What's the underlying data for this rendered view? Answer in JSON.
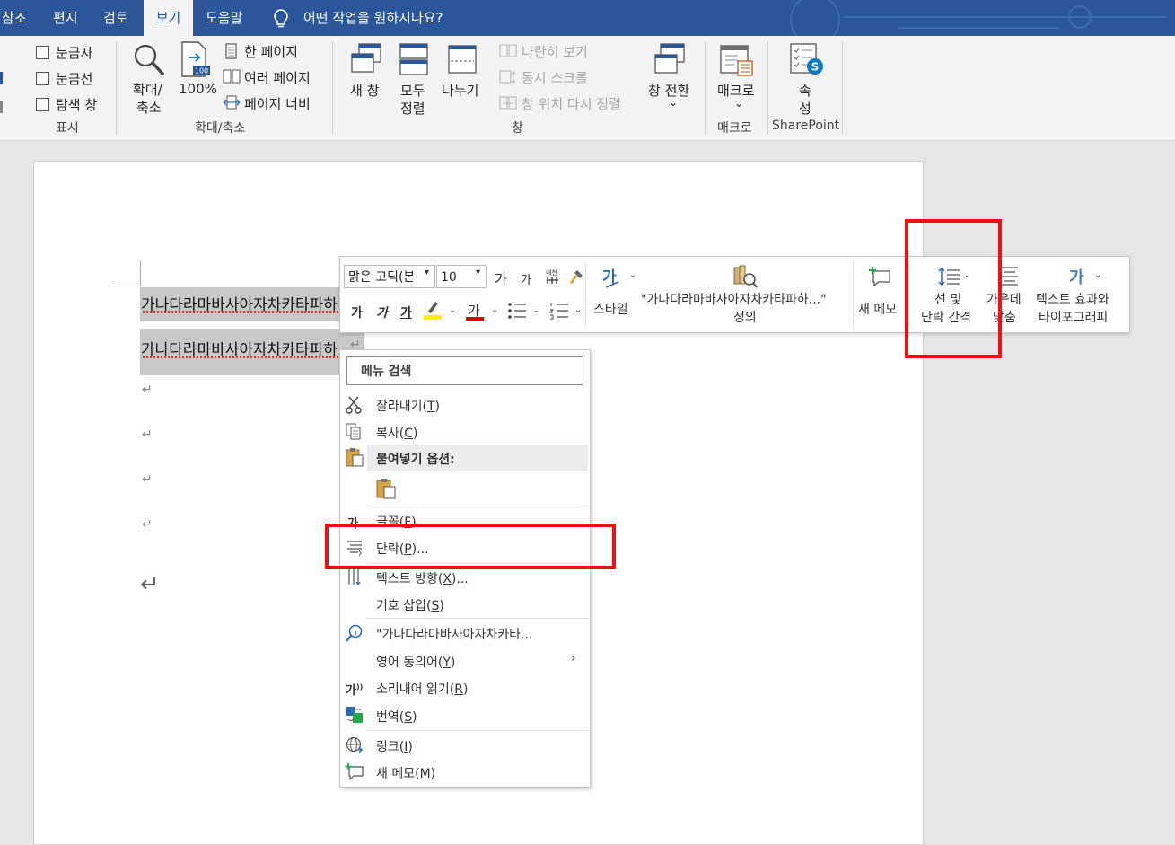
{
  "tabs": [
    {
      "label": "참조"
    },
    {
      "label": "편지"
    },
    {
      "label": "검토"
    },
    {
      "label": "보기",
      "active": true
    },
    {
      "label": "도움말"
    }
  ],
  "tell_me": "어떤 작업을 원하시나요?",
  "ribbon": {
    "show_group": {
      "ruler": "눈금자",
      "gridlines": "눈금선",
      "nav_pane": "탐색 창",
      "label": "표시"
    },
    "zoom_group": {
      "zoom_l1": "확대/",
      "zoom_l2": "축소",
      "hundred": "100%",
      "one_page": "한 페이지",
      "multi_page": "여러 페이지",
      "page_width": "페이지 너비",
      "label": "확대/축소"
    },
    "window_group": {
      "new_window": "새 창",
      "arrange_l1": "모두",
      "arrange_l2": "정렬",
      "split": "나누기",
      "side_by_side": "나란히 보기",
      "sync_scroll": "동시 스크롤",
      "reset_pos": "창 위치 다시 정렬",
      "switch": "창 전환",
      "label": "창"
    },
    "macro_group": {
      "macro": "매크로",
      "label": "매크로"
    },
    "sp_group": {
      "prop_l1": "속",
      "prop_l2": "성",
      "label": "SharePoint"
    },
    "chevron": "⌄"
  },
  "document": {
    "line1": "가나다라마바사아자차카타파하",
    "line2": "가나다라마바사아자차카타파하",
    "return_mark": "↵"
  },
  "mini_toolbar": {
    "font_name": "맑은 고딕(본",
    "font_size": "10",
    "grow_glyph": "가",
    "bold": "가",
    "italic": "가",
    "underline": "가",
    "font_color": "가",
    "style": "스타일",
    "define_l1": "\"가나다라마바사아자차카타파하...\"",
    "define_l2": "정의",
    "new_comment": "새 메모",
    "spacing_l1": "선 및",
    "spacing_l2": "단락 간격",
    "center_l1": "가운데",
    "center_l2": "맞춤",
    "effects_l1": "텍스트 효과와",
    "effects_l2": "타이포그래피",
    "effects_glyph": "가"
  },
  "context_menu": {
    "search": "메뉴 검색",
    "items": [
      {
        "label": "잘라내기(",
        "key": "T",
        "tail": ")"
      },
      {
        "label": "복사(",
        "key": "C",
        "tail": ")"
      },
      {
        "label": "붙여넣기 옵션:",
        "key": "",
        "tail": ""
      },
      {
        "label": "글꼴(",
        "key": "F",
        "tail": ")..."
      },
      {
        "label": "단락(",
        "key": "P",
        "tail": ")..."
      },
      {
        "label": "텍스트 방향(",
        "key": "X",
        "tail": ")..."
      },
      {
        "label": "기호 삽입(",
        "key": "S",
        "tail": ")"
      },
      {
        "label": "\"가나다라마바사아자차카타...",
        "key": "",
        "tail": ""
      },
      {
        "label": "영어 동의어(",
        "key": "Y",
        "tail": ")"
      },
      {
        "label": "소리내어 읽기(",
        "key": "R",
        "tail": ")"
      },
      {
        "label": "번역(",
        "key": "S",
        "tail": ")"
      },
      {
        "label": "링크(",
        "key": "I",
        "tail": ")"
      },
      {
        "label": "새 메모(",
        "key": "M",
        "tail": ")"
      }
    ],
    "icons": {
      "speak": "가"
    },
    "submenu_arrow": "›"
  },
  "colors": {
    "accent": "#2b579a",
    "highlight": "#ee1111"
  }
}
